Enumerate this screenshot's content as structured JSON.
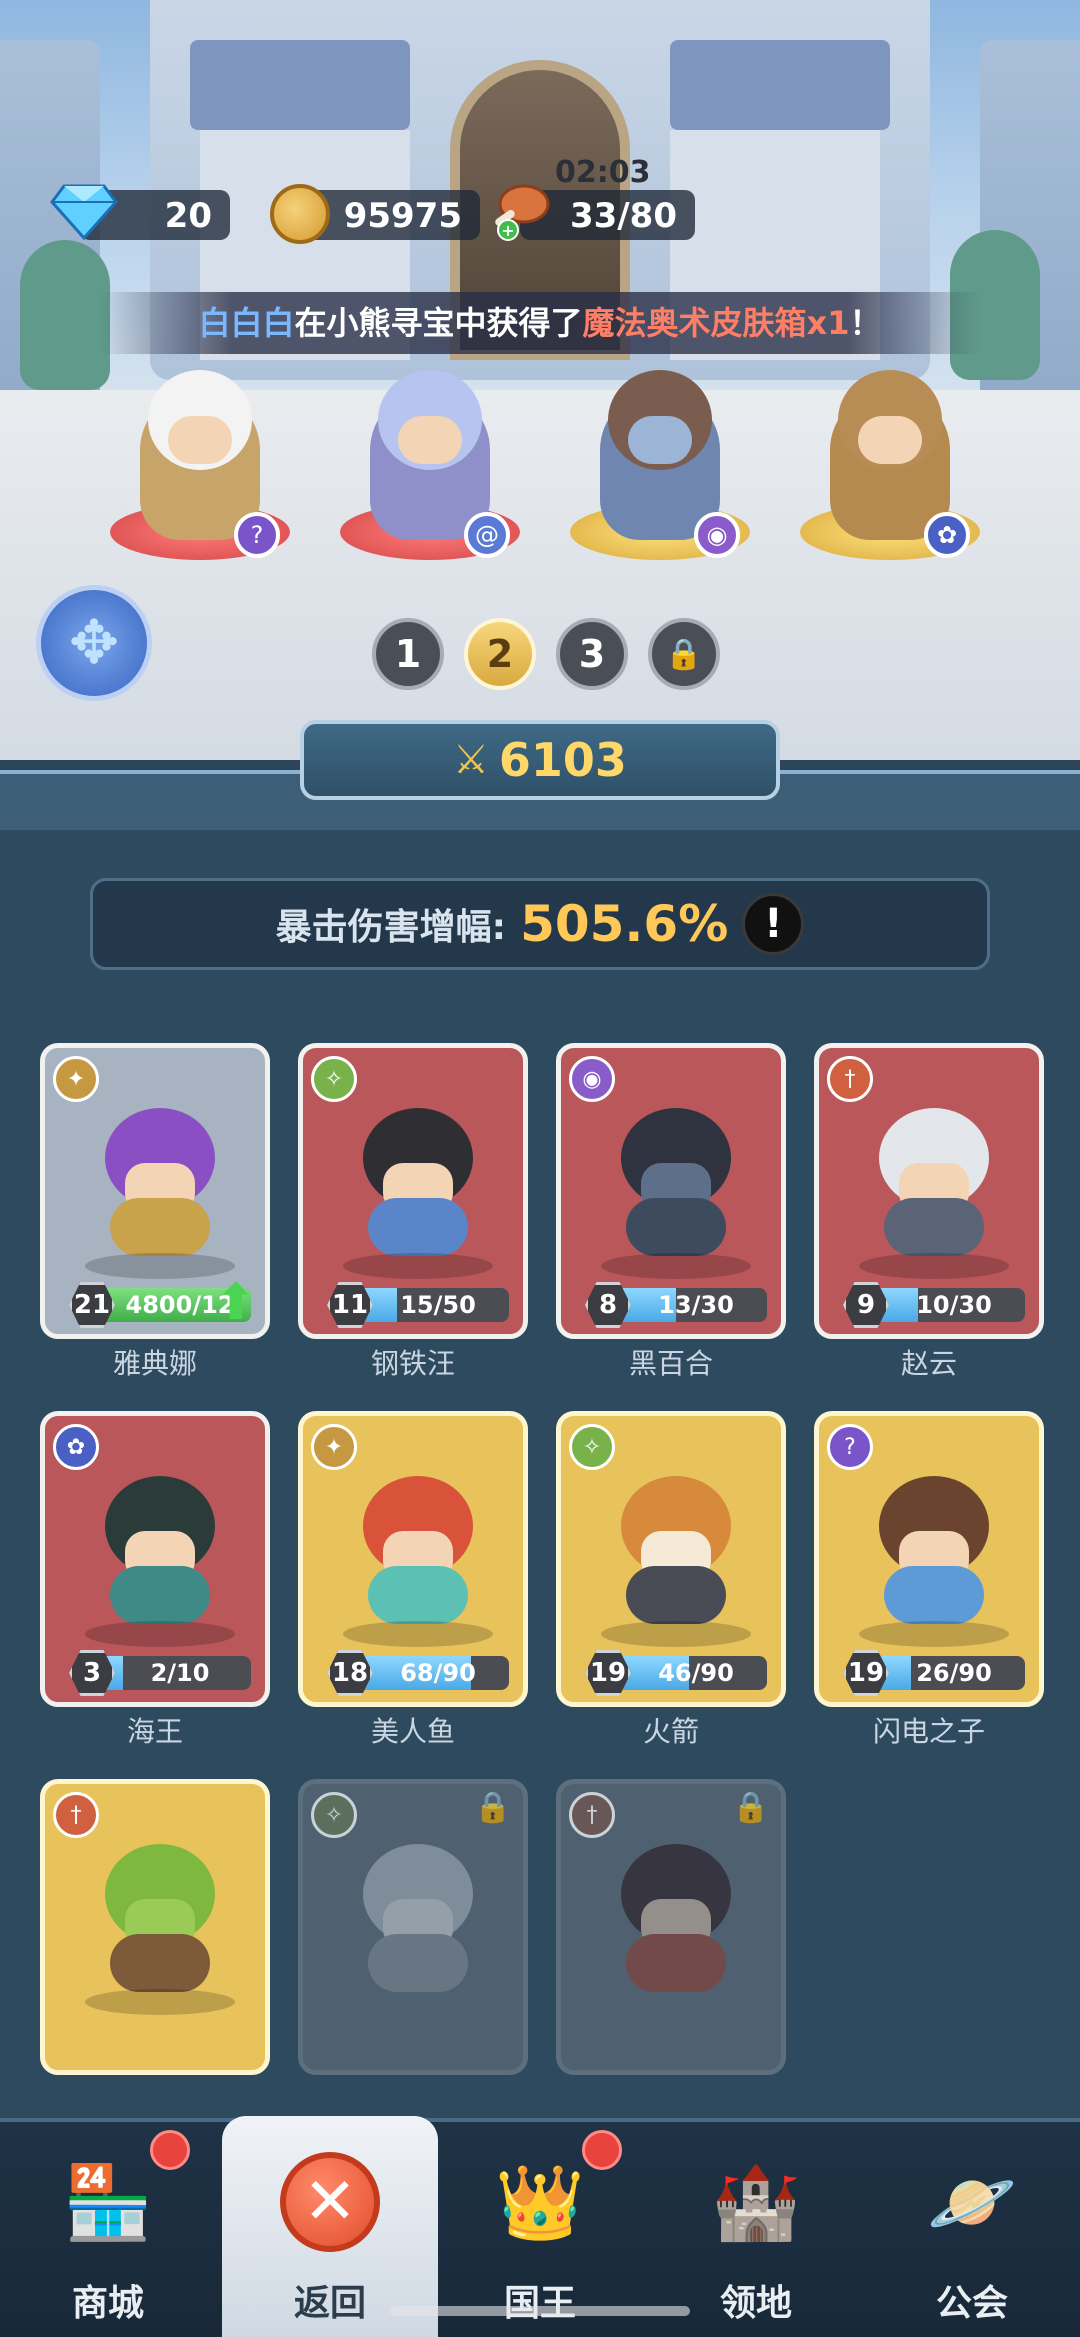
{
  "resources": {
    "gems": "20",
    "coins": "95975",
    "stamina": "33/80",
    "stamina_timer": "02:03"
  },
  "news": {
    "player": "白白白",
    "text_a": "在小熊寻宝中获得了",
    "item": "魔法奥术皮肤箱x1",
    "text_b": "！"
  },
  "team": {
    "heroes": [
      {
        "class_icon": "question-icon",
        "color": "#7a55c9"
      },
      {
        "class_icon": "swirl-icon",
        "color": "#5b7ad6"
      },
      {
        "class_icon": "eye-icon",
        "color": "#8a5cc9"
      },
      {
        "class_icon": "paw-icon",
        "color": "#4a60c4"
      }
    ],
    "pages": [
      "1",
      "2",
      "3"
    ],
    "active_page": "2"
  },
  "power": "6103",
  "stat": {
    "label": "暴击伤害增幅:",
    "value": "505.6%",
    "info": "!"
  },
  "cards": [
    {
      "name": "雅典娜",
      "level": "21",
      "progress": "4800/12",
      "fill": 1.0,
      "style": "gray",
      "class_icon": "wing-icon",
      "upgrade": true
    },
    {
      "name": "钢铁汪",
      "level": "11",
      "progress": "15/50",
      "fill": 0.3,
      "style": "red",
      "class_icon": "star-icon"
    },
    {
      "name": "黑百合",
      "level": "8",
      "progress": "13/30",
      "fill": 0.43,
      "style": "red",
      "class_icon": "eye-icon"
    },
    {
      "name": "赵云",
      "level": "9",
      "progress": "10/30",
      "fill": 0.33,
      "style": "red",
      "class_icon": "sword-icon"
    },
    {
      "name": "海王",
      "level": "3",
      "progress": "2/10",
      "fill": 0.2,
      "style": "red",
      "class_icon": "paw-icon"
    },
    {
      "name": "美人鱼",
      "level": "18",
      "progress": "68/90",
      "fill": 0.76,
      "style": "yellow",
      "class_icon": "wing-icon"
    },
    {
      "name": "火箭",
      "level": "19",
      "progress": "46/90",
      "fill": 0.51,
      "style": "yellow",
      "class_icon": "star-icon"
    },
    {
      "name": "闪电之子",
      "level": "19",
      "progress": "26/90",
      "fill": 0.29,
      "style": "yellow",
      "class_icon": "question-icon"
    },
    {
      "style": "yellow",
      "class_icon": "sword-icon"
    },
    {
      "style": "locked",
      "class_icon": "star-icon"
    },
    {
      "style": "locked",
      "class_icon": "sword-icon"
    }
  ],
  "nav": [
    {
      "label": "商城",
      "icon": "shop-icon",
      "badge": true
    },
    {
      "label": "返回",
      "icon": "close-icon",
      "active": true
    },
    {
      "label": "国王",
      "icon": "crown-icon",
      "badge": true
    },
    {
      "label": "领地",
      "icon": "castle-icon"
    },
    {
      "label": "公会",
      "icon": "planet-icon"
    }
  ],
  "colors": {
    "accent_gold": "#ffc857",
    "power_gold": "#ffd869",
    "badge_red": "#e8433d",
    "news_player": "#7bb7ff",
    "news_item": "#ff7e66"
  }
}
